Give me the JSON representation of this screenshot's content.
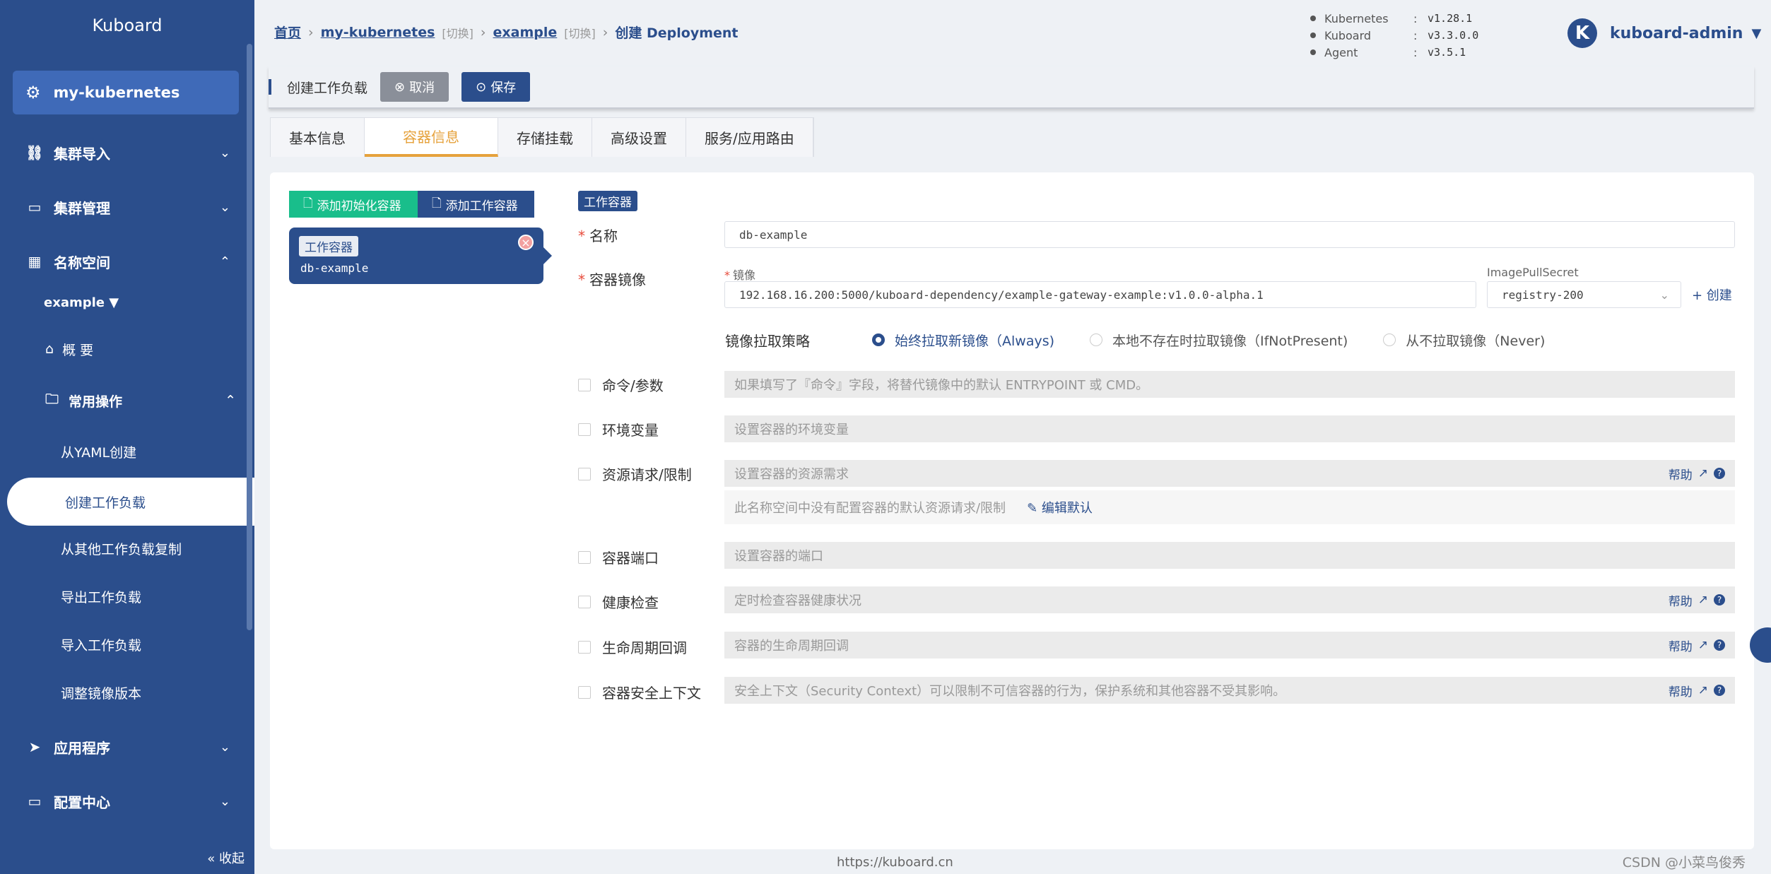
{
  "sidebar": {
    "brand": "Kuboard",
    "cluster": "my-kubernetes",
    "menu": {
      "import": "集群导入",
      "manage": "集群管理",
      "namespace": "名称空间",
      "apps": "应用程序",
      "config": "配置中心"
    },
    "namespace_value": "example",
    "overview": "概 要",
    "common_ops": "常用操作",
    "leaves": [
      "从YAML创建",
      "创建工作负载",
      "从其他工作负载复制",
      "导出工作负载",
      "导入工作负载",
      "调整镜像版本"
    ],
    "collapse": "« 收起"
  },
  "breadcrumb": {
    "home": "首页",
    "cluster": "my-kubernetes",
    "switch1": "[切换]",
    "namespace": "example",
    "switch2": "[切换]",
    "current": "创建 Deployment"
  },
  "versions": [
    {
      "name": "Kubernetes",
      "value": "v1.28.1"
    },
    {
      "name": "Kuboard",
      "value": "v3.3.0.0"
    },
    {
      "name": "Agent",
      "value": "v3.5.1"
    }
  ],
  "user": {
    "initial": "K",
    "name": "kuboard-admin"
  },
  "toolbar": {
    "title": "创建工作负载",
    "cancel": "取消",
    "save": "保存"
  },
  "tabs": [
    "基本信息",
    "容器信息",
    "存储挂载",
    "高级设置",
    "服务/应用路由"
  ],
  "containers": {
    "add_init": "添加初始化容器",
    "add_work": "添加工作容器",
    "card_tag": "工作容器",
    "card_name": "db-example"
  },
  "form": {
    "section": "工作容器",
    "name_label": "名称",
    "name_value": "db-example",
    "image_label": "容器镜像",
    "image_sub": "镜像",
    "image_value": "192.168.16.200:5000/kuboard-dependency/example-gateway-example:v1.0.0-alpha.1",
    "secret_label": "ImagePullSecret",
    "secret_value": "registry-200",
    "create": "+ 创建",
    "pull_policy_label": "镜像拉取策略",
    "pull_options": [
      "始终拉取新镜像（Always)",
      "本地不存在时拉取镜像（IfNotPresent)",
      "从不拉取镜像（Never)"
    ],
    "cmd_label": "命令/参数",
    "cmd_ph": "如果填写了『命令』字段，将替代镜像中的默认 ENTRYPOINT 或 CMD。",
    "env_label": "环境变量",
    "env_ph": "设置容器的环境变量",
    "res_label": "资源请求/限制",
    "res_ph": "设置容器的资源需求",
    "res_note": "此名称空间中没有配置容器的默认资源请求/限制",
    "res_edit": "编辑默认",
    "port_label": "容器端口",
    "port_ph": "设置容器的端口",
    "health_label": "健康检查",
    "health_ph": "定时检查容器健康状况",
    "life_label": "生命周期回调",
    "life_ph": "容器的生命周期回调",
    "sec_label": "容器安全上下文",
    "sec_ph": "安全上下文（Security Context）可以限制不可信容器的行为，保护系统和其他容器不受其影响。",
    "help": "帮助"
  },
  "footer": "https://kuboard.cn",
  "watermark": "CSDN @小菜鸟俊秀",
  "colors": {
    "primary": "#2b4e8c",
    "accent": "#e6a23c",
    "success": "#19be8b"
  }
}
